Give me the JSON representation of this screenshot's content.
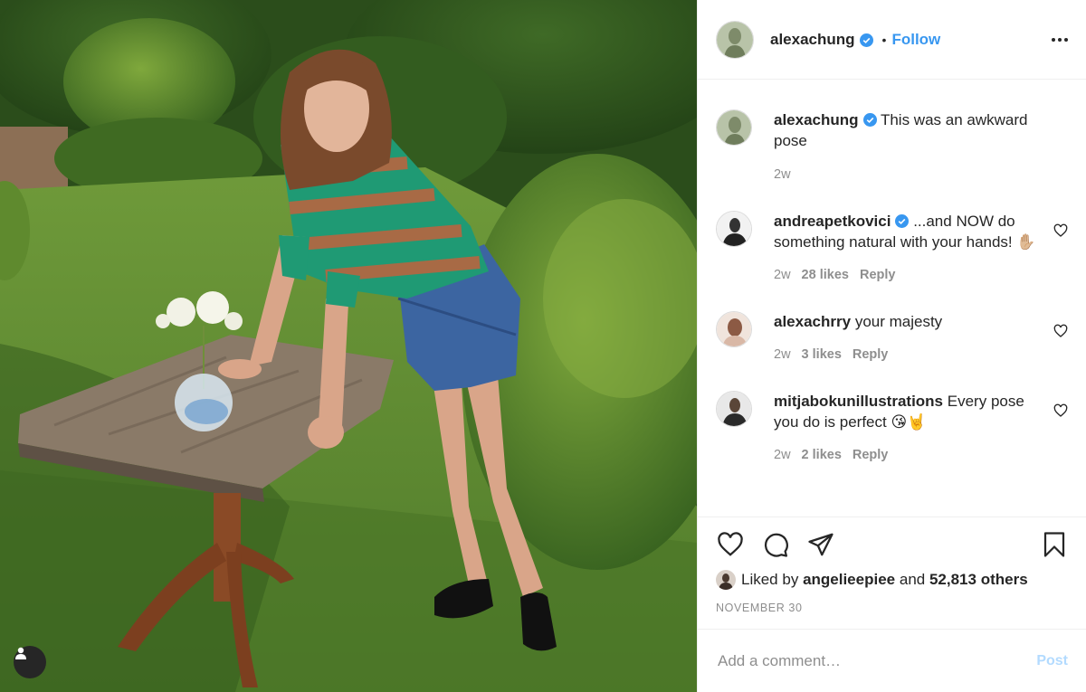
{
  "author": {
    "username": "alexachung",
    "verified": true,
    "follow_label": "Follow",
    "separator": "•"
  },
  "caption": {
    "username": "alexachung",
    "text": "This was an awkward pose",
    "time": "2w"
  },
  "comments": [
    {
      "username": "andreapetkovici",
      "verified": true,
      "text": "...and NOW do something natural with your hands! ✋🏼",
      "time": "2w",
      "likes": "28 likes",
      "reply_label": "Reply"
    },
    {
      "username": "alexachrry",
      "verified": false,
      "text": "your majesty",
      "time": "2w",
      "likes": "3 likes",
      "reply_label": "Reply"
    },
    {
      "username": "mitjabokunillustrations",
      "verified": false,
      "text": "Every pose you do is perfect 😘🤘",
      "time": "2w",
      "likes": "2 likes",
      "reply_label": "Reply"
    }
  ],
  "likes": {
    "prefix": "Liked by",
    "user": "angelieepiee",
    "joiner": "and",
    "others": "52,813 others"
  },
  "date": "NOVEMBER 30",
  "add_comment": {
    "placeholder": "Add a comment…",
    "post_label": "Post"
  },
  "icons": {
    "verified": "verified-badge-icon",
    "more": "more-options-icon",
    "like": "heart-icon",
    "comment": "comment-bubble-icon",
    "share": "paper-plane-icon",
    "save": "bookmark-icon",
    "tag": "user-tag-icon"
  },
  "colors": {
    "accent": "#3897f0",
    "text": "#262626",
    "muted": "#8e8e8e",
    "post_disabled": "#b3dbff"
  }
}
